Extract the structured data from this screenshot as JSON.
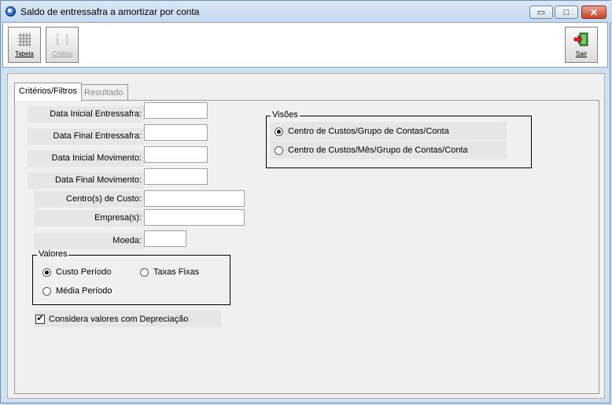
{
  "window": {
    "title": "Saldo de entressafra a amortizar por conta",
    "minimize_glyph": "▭",
    "maximize_glyph": "□",
    "close_glyph": "✕"
  },
  "toolbar": {
    "tabela": {
      "label": "Tabela",
      "icon": "grid-icon"
    },
    "criterio": {
      "label": "Critério",
      "icon": "criteria-icon",
      "enabled": false
    },
    "sair": {
      "label": "Sair",
      "icon": "exit-door-icon"
    }
  },
  "tabs": [
    {
      "label": "Critérios/Filtros",
      "active": true
    },
    {
      "label": "Resultado",
      "active": false
    }
  ],
  "fields": {
    "data_inicial_entressafra": {
      "label": "Data Inicial Entressafra:",
      "value": ""
    },
    "data_final_entressafra": {
      "label": "Data Final Entressafra:",
      "value": ""
    },
    "data_inicial_movimento": {
      "label": "Data Inicial Movimento:",
      "value": ""
    },
    "data_final_movimento": {
      "label": "Data Final Movimento:",
      "value": ""
    },
    "centros_custo": {
      "label": "Centro(s) de Custo:",
      "value": ""
    },
    "empresas": {
      "label": "Empresa(s):",
      "value": ""
    },
    "moeda": {
      "label": "Moeda:",
      "value": ""
    }
  },
  "valores": {
    "title": "Valores",
    "options": [
      {
        "label": "Custo Período",
        "selected": true
      },
      {
        "label": "Taxas Fixas",
        "selected": false
      },
      {
        "label": "Média Período",
        "selected": false
      }
    ]
  },
  "visoes": {
    "title": "Visões",
    "options": [
      {
        "label": "Centro de Custos/Grupo de Contas/Conta",
        "selected": true
      },
      {
        "label": "Centro de Custos/Mês/Grupo de Contas/Conta",
        "selected": false
      }
    ]
  },
  "depreciacao": {
    "label": "Considera valores com Depreciação",
    "checked": true,
    "check_glyph": "✔"
  }
}
